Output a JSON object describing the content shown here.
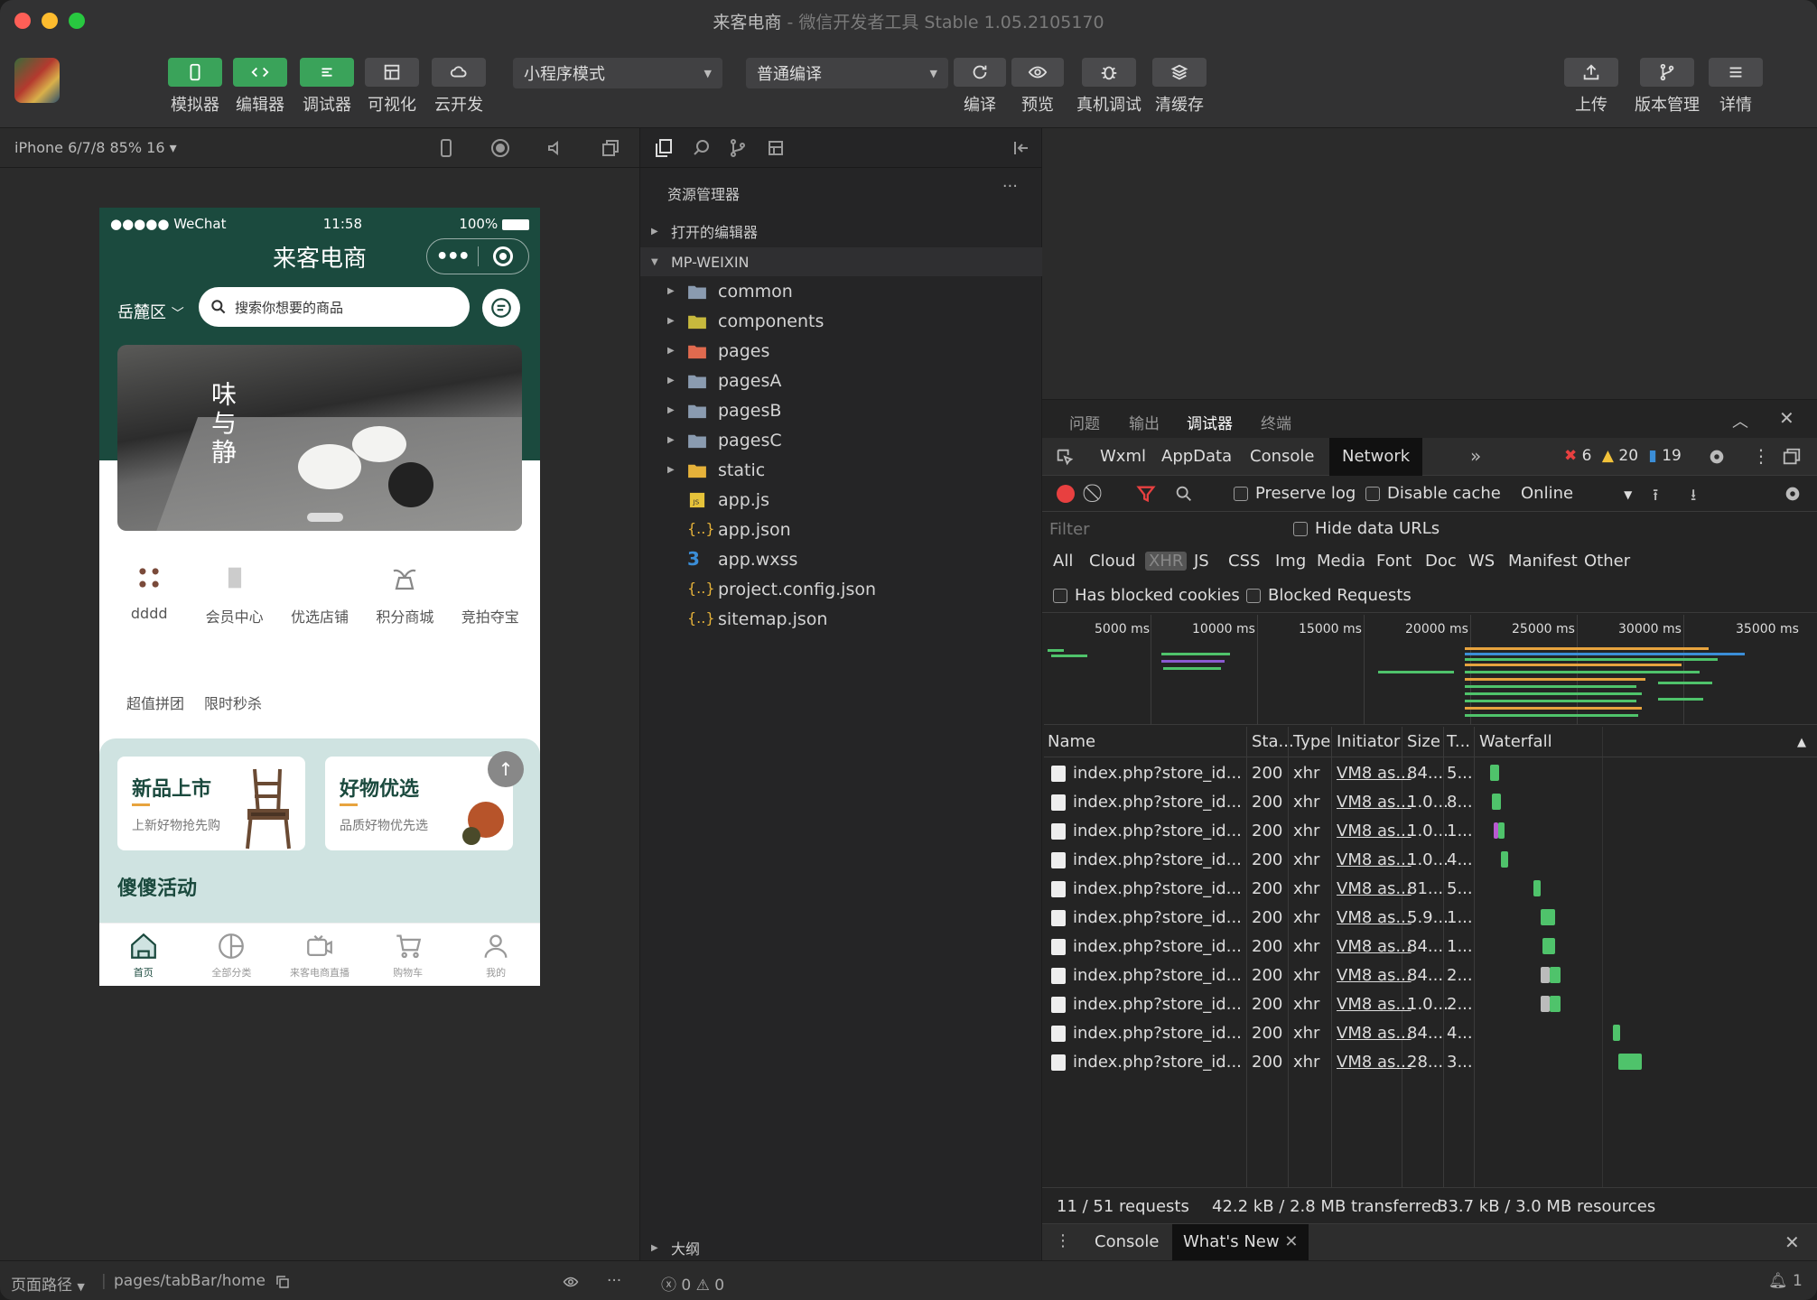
{
  "window": {
    "title": "来客电商",
    "subtitle": "- 微信开发者工具 Stable 1.05.2105170",
    "traffic_colors": [
      "#fe5f57",
      "#febc2e",
      "#28c840"
    ]
  },
  "toolbar": {
    "simulator": "模拟器",
    "editor": "编辑器",
    "debugger": "调试器",
    "visual": "可视化",
    "cloud": "云开发",
    "mode_select": "小程序模式",
    "compile_select": "普通编译",
    "compile": "编译",
    "preview": "预览",
    "real_debug": "真机调试",
    "clear_cache": "清缓存",
    "upload": "上传",
    "version": "版本管理",
    "details": "详情"
  },
  "simulator": {
    "device": "iPhone 6/7/8 85% 16 ▾"
  },
  "phone": {
    "status_left": "●●●●● WeChat",
    "status_time": "11:58",
    "status_right": "100%",
    "app_title": "来客电商",
    "region": "岳麓区",
    "search_placeholder": "搜索你想要的商品",
    "banner_text": "味与静",
    "categories": [
      "dddd",
      "会员中心",
      "优选店铺",
      "积分商城",
      "竞拍夺宝"
    ],
    "links": [
      "超值拼团",
      "限时秒杀"
    ],
    "promo_cards": [
      {
        "title": "新品上市",
        "sub": "上新好物抢先购"
      },
      {
        "title": "好物优选",
        "sub": "品质好物优先选"
      }
    ],
    "activity_title": "傻傻活动",
    "tabs": [
      "首页",
      "全部分类",
      "来客电商直播",
      "购物车",
      "我的"
    ],
    "brand_color": "#1b4a3e"
  },
  "statusbar": {
    "path_label": "页面路径",
    "path": "pages/tabBar/home",
    "errors": "0",
    "warnings": "0",
    "bell_count": "1"
  },
  "explorer": {
    "title": "资源管理器",
    "open_editors": "打开的编辑器",
    "project": "MP-WEIXIN",
    "outline": "大纲",
    "folders": [
      "common",
      "components",
      "pages",
      "pagesA",
      "pagesB",
      "pagesC",
      "static"
    ],
    "files": [
      "app.js",
      "app.json",
      "app.wxss",
      "project.config.json",
      "sitemap.json"
    ]
  },
  "devtools": {
    "top_tabs": [
      "问题",
      "输出",
      "调试器",
      "终端"
    ],
    "panel_tabs": [
      "Wxml",
      "AppData",
      "Console",
      "Network"
    ],
    "error_count": "6",
    "warning_count": "20",
    "info_count": "19",
    "preserve_log": "Preserve log",
    "disable_cache": "Disable cache",
    "throttle": "Online",
    "filter_placeholder": "Filter",
    "hide_data_urls": "Hide data URLs",
    "types": [
      "All",
      "Cloud",
      "XHR",
      "JS",
      "CSS",
      "Img",
      "Media",
      "Font",
      "Doc",
      "WS",
      "Manifest",
      "Other"
    ],
    "has_blocked_cookies": "Has blocked cookies",
    "blocked_requests": "Blocked Requests",
    "overview_ticks": [
      "5000 ms",
      "10000 ms",
      "15000 ms",
      "20000 ms",
      "25000 ms",
      "30000 ms",
      "35000 ms"
    ],
    "columns": [
      "Name",
      "Sta...",
      "Type",
      "Initiator",
      "Size",
      "T...",
      "Waterfall"
    ],
    "rows": [
      {
        "name": "index.php?store_id...",
        "status": "200",
        "type": "xhr",
        "initiator": "VM8 as...",
        "size": "84...",
        "time": "5..."
      },
      {
        "name": "index.php?store_id...",
        "status": "200",
        "type": "xhr",
        "initiator": "VM8 as...",
        "size": "1.0...",
        "time": "8..."
      },
      {
        "name": "index.php?store_id...",
        "status": "200",
        "type": "xhr",
        "initiator": "VM8 as...",
        "size": "1.0...",
        "time": "1..."
      },
      {
        "name": "index.php?store_id...",
        "status": "200",
        "type": "xhr",
        "initiator": "VM8 as...",
        "size": "1.0...",
        "time": "4..."
      },
      {
        "name": "index.php?store_id...",
        "status": "200",
        "type": "xhr",
        "initiator": "VM8 as...",
        "size": "81...",
        "time": "5..."
      },
      {
        "name": "index.php?store_id...",
        "status": "200",
        "type": "xhr",
        "initiator": "VM8 as...",
        "size": "5.9...",
        "time": "1..."
      },
      {
        "name": "index.php?store_id...",
        "status": "200",
        "type": "xhr",
        "initiator": "VM8 as...",
        "size": "84...",
        "time": "1..."
      },
      {
        "name": "index.php?store_id...",
        "status": "200",
        "type": "xhr",
        "initiator": "VM8 as...",
        "size": "84...",
        "time": "2..."
      },
      {
        "name": "index.php?store_id...",
        "status": "200",
        "type": "xhr",
        "initiator": "VM8 as...",
        "size": "1.0...",
        "time": "2..."
      },
      {
        "name": "index.php?store_id...",
        "status": "200",
        "type": "xhr",
        "initiator": "VM8 as...",
        "size": "84...",
        "time": "4..."
      },
      {
        "name": "index.php?store_id...",
        "status": "200",
        "type": "xhr",
        "initiator": "VM8 as...",
        "size": "28...",
        "time": "3..."
      }
    ],
    "summary_requests": "11 / 51 requests",
    "summary_transferred": "42.2 kB / 2.8 MB transferred",
    "summary_resources": "33.7 kB / 3.0 MB resources",
    "drawer_tabs": [
      "Console",
      "What's New"
    ]
  }
}
